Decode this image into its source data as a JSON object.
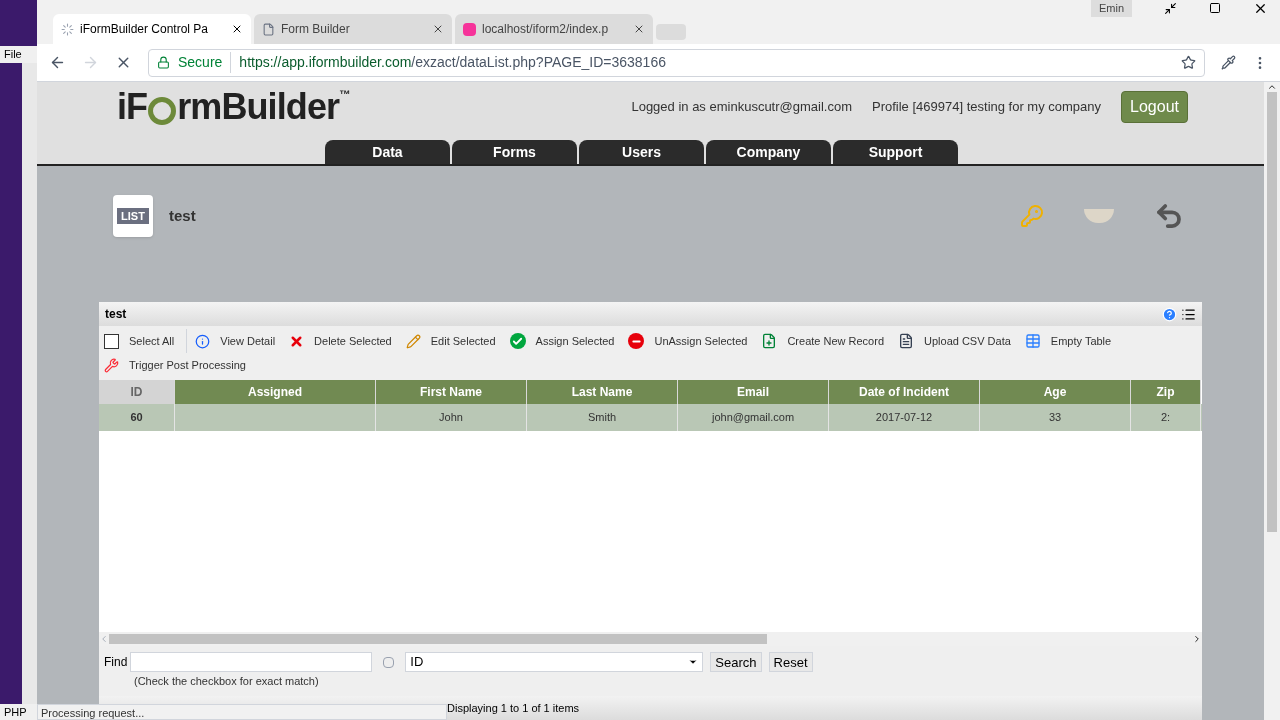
{
  "desktop": {
    "menu_label": "File",
    "taskbar_label": "PHP"
  },
  "browser": {
    "tabs": [
      {
        "title": "iFormBuilder Control Pa",
        "selected": true,
        "kind": "loading"
      },
      {
        "title": "Form Builder",
        "selected": false,
        "kind": "page"
      },
      {
        "title": "localhost/iform2/index.p",
        "selected": false,
        "kind": "site"
      }
    ],
    "user": "Emin",
    "secure_label": "Secure",
    "url_host": "https://app.iformbuilder.com",
    "url_path": "/exzact/dataList.php?PAGE_ID=3638166",
    "status": "Processing request..."
  },
  "header": {
    "logo": {
      "before": "iF",
      "after": "rmBuilder",
      "mark": "™"
    },
    "logged_in": "Logged in as eminkuscutr@gmail.com",
    "profile": "Profile [469974] testing for my company",
    "logout": "Logout",
    "nav": [
      {
        "label": "Data",
        "selected": false
      },
      {
        "label": "Forms",
        "selected": false
      },
      {
        "label": "Users",
        "selected": false
      },
      {
        "label": "Company",
        "selected": false
      },
      {
        "label": "Support",
        "selected": false
      }
    ]
  },
  "page": {
    "badge": "LIST",
    "title": "test"
  },
  "grid": {
    "title": "test",
    "toolbar": [
      {
        "label": "Select All",
        "kind": "checkbox",
        "checked": false
      },
      {
        "label": "View Detail",
        "kind": "info"
      },
      {
        "label": "Delete Selected",
        "kind": "delete"
      },
      {
        "label": "Edit Selected",
        "kind": "edit"
      },
      {
        "label": "Assign Selected",
        "kind": "assign"
      },
      {
        "label": "UnAssign Selected",
        "kind": "unassign"
      },
      {
        "label": "Create New Record",
        "kind": "create"
      },
      {
        "label": "Upload CSV Data",
        "kind": "csv"
      },
      {
        "label": "Empty Table",
        "kind": "empty"
      },
      {
        "label": "Trigger Post Processing",
        "kind": "tools"
      }
    ],
    "columns": [
      {
        "label": "ID",
        "sorted": true
      },
      {
        "label": "Assigned",
        "sorted": false
      },
      {
        "label": "First Name",
        "sorted": false
      },
      {
        "label": "Last Name",
        "sorted": false
      },
      {
        "label": "Email",
        "sorted": false
      },
      {
        "label": "Date of Incident",
        "sorted": false
      },
      {
        "label": "Age",
        "sorted": false
      },
      {
        "label": "Zip",
        "sorted": false
      }
    ],
    "rows": [
      {
        "selected": true,
        "cells": [
          "60",
          "",
          "John",
          "Smith",
          "john@gmail.com",
          "2017-07-12",
          "33",
          "2:"
        ]
      }
    ],
    "find": {
      "label": "Find",
      "hint": "(Check the checkbox for exact match)",
      "exact": false,
      "field": "ID",
      "search": "Search",
      "reset": "Reset"
    },
    "pager": "Displaying 1 to 1 of 1 items"
  }
}
